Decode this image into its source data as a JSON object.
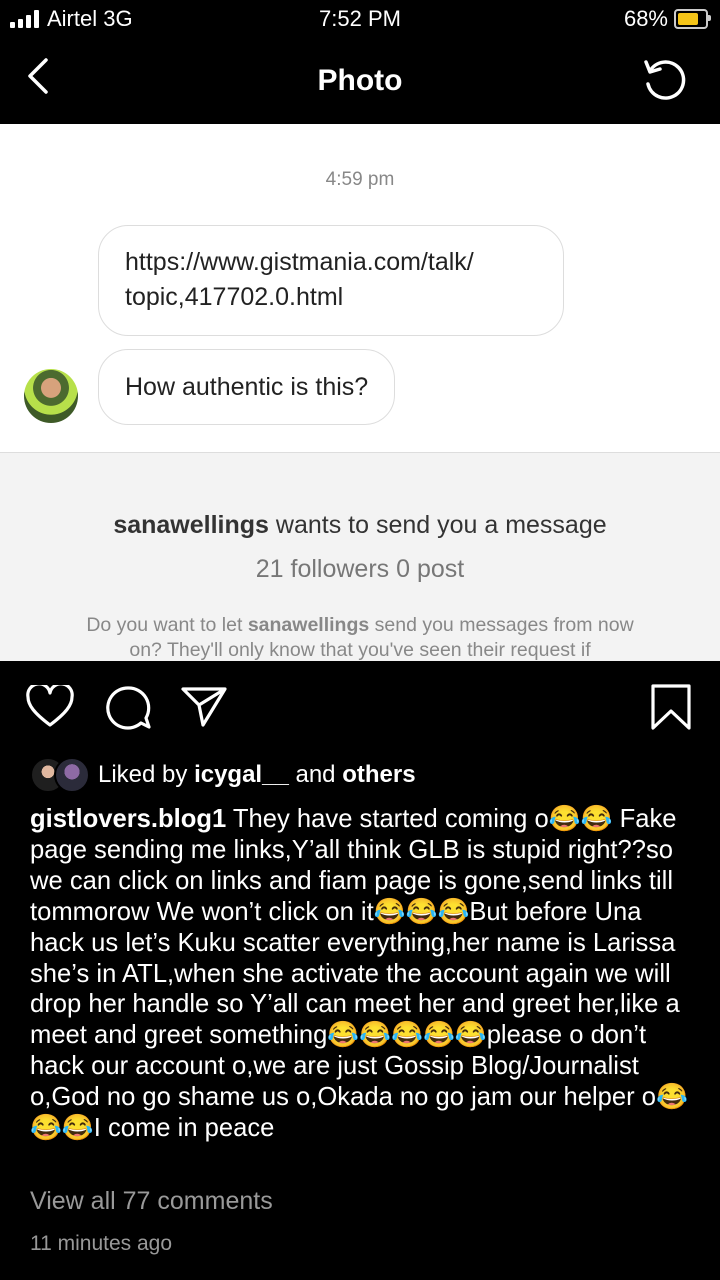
{
  "status_bar": {
    "carrier": "Airtel 3G",
    "time": "7:52 PM",
    "battery": "68%",
    "battery_color": "#f5c518"
  },
  "nav": {
    "title": "Photo",
    "back_icon": "chevron-left-icon",
    "rotate_icon": "rotate-icon"
  },
  "photo": {
    "timestamp": "4:59 pm",
    "message_1_line_1": "https://www.gistmania.com/talk/",
    "message_1_line_2": "topic,417702.0.html",
    "message_2": "How authentic is this?",
    "request_username": "sanawellings",
    "request_text": " wants to send you a message",
    "request_stats": "21 followers 0 post",
    "request_prompt_1": "Do you want to let ",
    "request_prompt_user": "sanawellings",
    "request_prompt_2": " send you messages from now on? They'll only know that you've seen their request if"
  },
  "post": {
    "liked_prefix": "Liked by ",
    "liked_user": "icygal__",
    "liked_mid": " and ",
    "liked_others": "others",
    "caption_user": "gistlovers.blog1",
    "caption_text": " They have started coming o😂😂 Fake page sending me links,Y’all think GLB is stupid right??so we can click on links and fiam page is gone,send links till tommorow We won’t click on it😂😂😂But before Una hack us let’s Kuku scatter everything,her name is Larissa she’s in ATL,when she activate the account again we will drop her handle so Y’all can meet her and greet her,like a meet and greet something😂😂😂😂😂please o don’t hack our account o,we are just Gossip Blog/Journalist o,God no go shame us o,Okada no go jam our helper o😂😂😂I come in peace",
    "view_comments": "View all 77 comments",
    "time_ago": "11 minutes ago"
  }
}
